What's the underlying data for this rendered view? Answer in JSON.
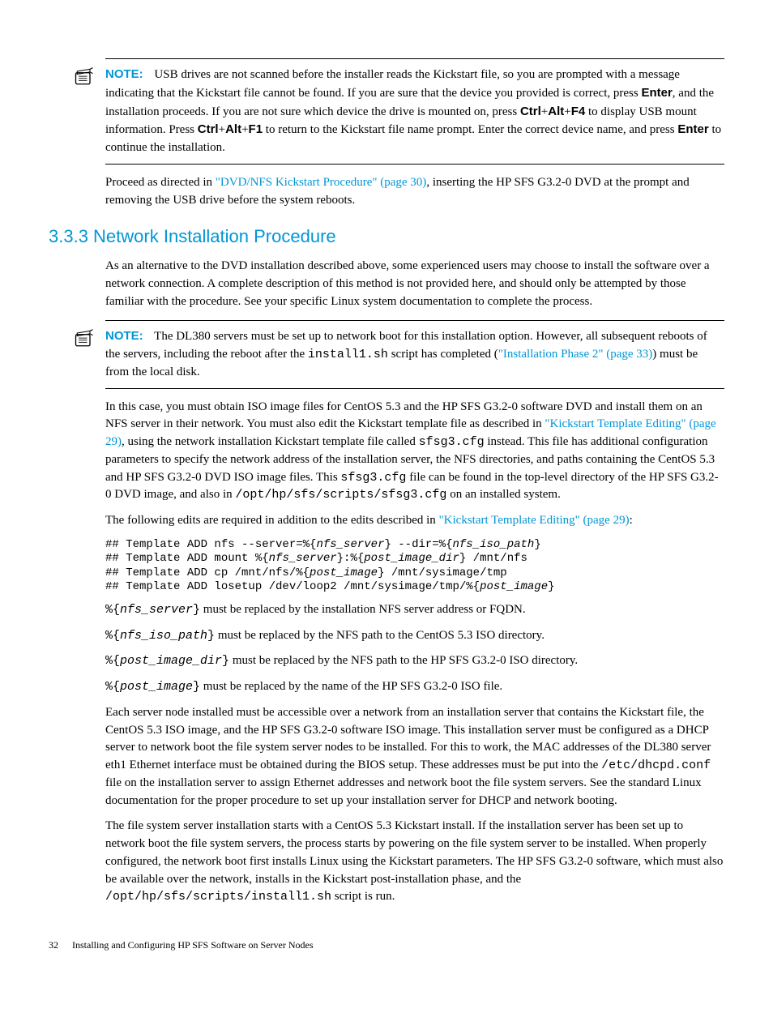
{
  "note1": {
    "label": "NOTE:",
    "seg1": "USB drives are not scanned before the installer reads the Kickstart file, so you are prompted with a message indicating that the Kickstart file cannot be found. If you are sure that the device you provided is correct, press ",
    "k1": "Enter",
    "seg2": ", and the installation proceeds. If you are not sure which device the drive is mounted on, press ",
    "k2": "Ctrl",
    "plus": "+",
    "k3": "Alt",
    "k4": "F4",
    "seg3": " to display USB mount information. Press ",
    "k5": "Ctrl",
    "k6": "Alt",
    "k7": "F1",
    "seg4": " to return to the Kickstart file name prompt. Enter the correct device name, and press ",
    "k8": "Enter",
    "seg5": " to continue the installation."
  },
  "p1": {
    "seg1": "Proceed as directed in ",
    "link": "\"DVD/NFS Kickstart Procedure\" (page 30)",
    "seg2": ", inserting the HP SFS G3.2-0 DVD at the prompt and removing the USB drive before the system reboots."
  },
  "heading": "3.3.3  Network Installation Procedure",
  "p2": "As an alternative to the DVD installation described above, some experienced users may choose to install the software over a network connection. A complete description of this method is not provided here, and should only be attempted by those familiar with the procedure. See your specific Linux system documentation to complete the process.",
  "note2": {
    "label": "NOTE:",
    "seg1": "The DL380 servers must be set up to network boot for this installation option. However, all subsequent reboots of the servers, including the reboot after the ",
    "code1": "install1.sh",
    "seg2": " script has completed (",
    "link": "\"Installation Phase 2\" (page 33)",
    "seg3": ") must be from the local disk."
  },
  "p3": {
    "seg1": "In this case, you must obtain ISO image files for CentOS 5.3 and the HP SFS G3.2-0 software DVD and install them on an NFS server in their network. You must also edit the Kickstart template file as described in ",
    "link": "\"Kickstart Template Editing\" (page 29)",
    "seg2": ", using the network installation Kickstart template file called ",
    "code1": "sfsg3.cfg",
    "seg3": " instead. This file has additional configuration parameters to specify the network address of the installation server, the NFS directories, and paths containing the CentOS 5.3 and HP SFS G3.2-0 DVD ISO image files. This ",
    "code2": "sfsg3.cfg",
    "seg4": " file can be found in the top-level directory of the HP SFS G3.2-0 DVD image, and also in ",
    "code3": "/opt/hp/sfs/scripts/sfsg3.cfg",
    "seg5": " on an installed system."
  },
  "p4": {
    "seg1": "The following edits are required in addition to the edits described in ",
    "link": "\"Kickstart Template Editing\" (page 29)",
    "seg2": ":"
  },
  "code": {
    "l1a": "## Template ADD nfs --server=%{",
    "l1b": "nfs_server",
    "l1c": "} --dir=%{",
    "l1d": "nfs_iso_path",
    "l1e": "}",
    "l2a": "## Template ADD mount %{",
    "l2b": "nfs_server",
    "l2c": "}:%{",
    "l2d": "post_image_dir",
    "l2e": "} /mnt/nfs",
    "l3a": "## Template ADD cp /mnt/nfs/%{",
    "l3b": "post_image",
    "l3c": "} /mnt/sysimage/tmp",
    "l4a": "## Template ADD losetup /dev/loop2 /mnt/sysimage/tmp/%{",
    "l4b": "post_image",
    "l4c": "}"
  },
  "r1": {
    "a": "%{",
    "b": "nfs_server",
    "c": "}",
    "t": " must be replaced by the installation NFS server address or FQDN."
  },
  "r2": {
    "a": "%{",
    "b": "nfs_iso_path",
    "c": "}",
    "t": " must be replaced by the NFS path to the CentOS 5.3 ISO directory."
  },
  "r3": {
    "a": "%{",
    "b": "post_image_dir",
    "c": "}",
    "t": " must be replaced by the NFS path to the HP SFS G3.2-0 ISO directory."
  },
  "r4": {
    "a": "%{",
    "b": "post_image",
    "c": "}",
    "t": " must be replaced by the name of the HP SFS G3.2-0 ISO file."
  },
  "p5": {
    "seg1": "Each server node installed must be accessible over a network from an installation server that contains the Kickstart file, the CentOS 5.3 ISO image, and the HP SFS G3.2-0 software ISO image. This installation server must be configured as a DHCP server to network boot the file system server nodes to be installed. For this to work, the MAC addresses of the DL380 server eth1 Ethernet interface must be obtained during the BIOS setup. These addresses must be put into the ",
    "code1": "/etc/dhcpd.conf",
    "seg2": " file on the installation server to assign Ethernet addresses and network boot the file system servers. See the standard Linux documentation for the proper procedure to set up your installation server for DHCP and network booting."
  },
  "p6": {
    "seg1": "The file system server installation starts with a CentOS 5.3 Kickstart install. If the installation server has been set up to network boot the file system servers, the process starts by powering on the file system server to be installed. When properly configured, the network boot first installs Linux using the Kickstart parameters. The HP SFS G3.2-0 software, which must also be available over the network, installs in the Kickstart post-installation phase, and the ",
    "code1": "/opt/hp/sfs/scripts/install1.sh",
    "seg2": " script is run."
  },
  "footer": {
    "page": "32",
    "title": "Installing and Configuring HP SFS Software on Server Nodes"
  }
}
